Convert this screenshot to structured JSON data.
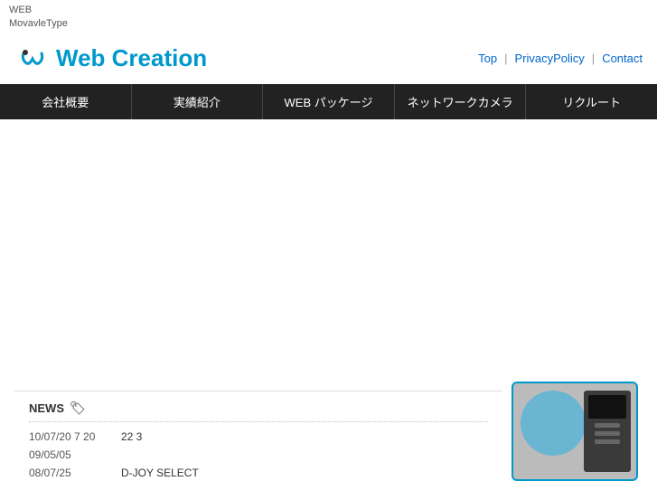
{
  "topbar": {
    "line1": "WEB",
    "line2": "MovavleType"
  },
  "header": {
    "logo_text_plain": "Web ",
    "logo_text_colored": "Creation",
    "nav": {
      "top": "Top",
      "sep1": "|",
      "privacy": "PrivacyPolicy",
      "sep2": "|",
      "contact": "Contact"
    }
  },
  "navbar": {
    "items": [
      {
        "label": "会社概要"
      },
      {
        "label": "実績紹介"
      },
      {
        "label": "WEB パッケージ"
      },
      {
        "label": "ネットワークカメラ"
      },
      {
        "label": "リクルート"
      }
    ]
  },
  "news": {
    "header": "NEWS",
    "items": [
      {
        "date": "10/07/20 7 20",
        "text": "22  3"
      },
      {
        "date": "09/05/05",
        "text": ""
      },
      {
        "date": "08/07/25",
        "text": "D-JOY SELECT"
      }
    ]
  }
}
